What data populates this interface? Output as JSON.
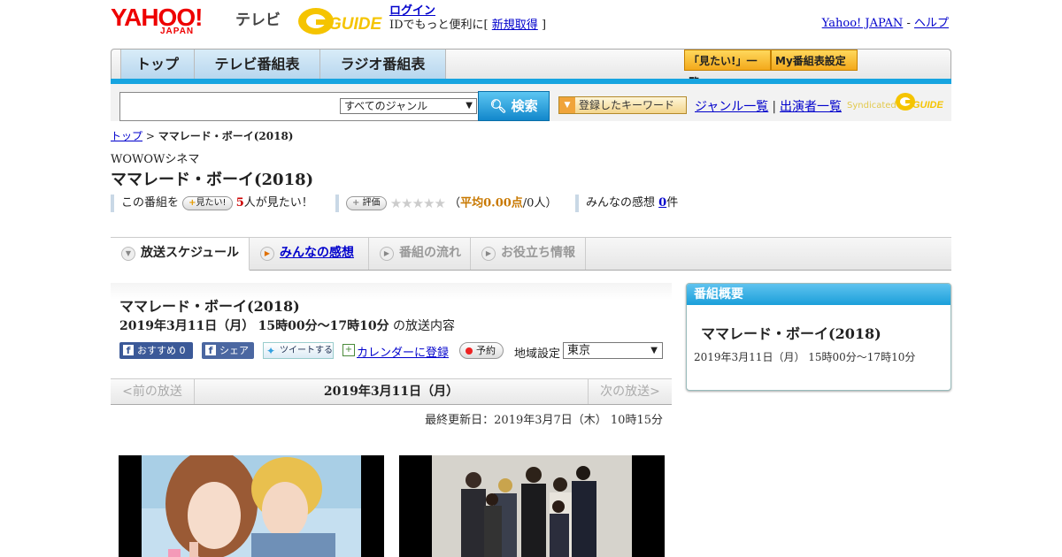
{
  "header": {
    "logo_yahoo": "YAHOO!",
    "logo_japan": "JAPAN",
    "logo_tv": "テレビ",
    "logo_gguide": "GUIDE",
    "login_label": "ログイン",
    "login_text": "IDでもっと便利に[",
    "signup_label": "新規取得",
    "login_close": "]",
    "yahoo_japan_link": "Yahoo! JAPAN",
    "separator": "-",
    "help_link": "ヘルプ"
  },
  "nav": {
    "tabs": [
      "トップ",
      "テレビ番組表",
      "ラジオ番組表"
    ],
    "mitai_list": "「見たい!」一覧",
    "my_bangumi": "My番組表設定"
  },
  "search": {
    "genre_selected": "すべてのジャンル",
    "button_label": "検索",
    "keyword_button": "登録したキーワード",
    "genre_list": "ジャンル一覧",
    "link_sep": "|",
    "performers_list": "出演者一覧",
    "syndicated": "Syndicated"
  },
  "breadcrumb": {
    "top": "トップ",
    "sep": ">",
    "current": "ママレード・ボーイ(2018)"
  },
  "program": {
    "channel": "WOWOWシネマ",
    "title": "ママレード・ボーイ(2018)"
  },
  "stats": {
    "this_program": "この番組を",
    "mitai_button": "見たい!",
    "mitai_count": "5",
    "mitai_suffix": "人が見たい！",
    "rate_button": "評価",
    "stars": "★★★★★",
    "avg_open": "（",
    "avg_label": "平均0.00点",
    "avg_people": "/0人）",
    "kansou_label": "みんなの感想",
    "kansou_count": "0",
    "kansou_suffix": "件"
  },
  "program_tabs": [
    "放送スケジュール",
    "みんなの感想",
    "番組の流れ",
    "お役立ち情報"
  ],
  "broadcast": {
    "title": "ママレード・ボーイ(2018)",
    "date": "2019年3月11日（月）",
    "time": "15時00分～17時10分",
    "suffix": "の放送内容",
    "fb_recommend": "おすすめ 0",
    "fb_share": "シェア",
    "tweet": "ツイートする",
    "calendar": "カレンダーに登録",
    "reserve": "予約",
    "region_label": "地域設定",
    "region_value": "東京"
  },
  "date_nav": {
    "prev": "<前の放送",
    "current": "2019年3月11日（月）",
    "next": "次の放送>"
  },
  "updated": "最終更新日：2019年3月7日（木） 10時15分",
  "summary": {
    "header": "番組概要",
    "title": "ママレード・ボーイ(2018)",
    "datetime": "2019年3月11日（月） 15時00分～17時10分"
  },
  "colors": {
    "accent_blue": "#17a4e0",
    "yahoo_red": "#ee0000",
    "link": "#0000cc"
  }
}
